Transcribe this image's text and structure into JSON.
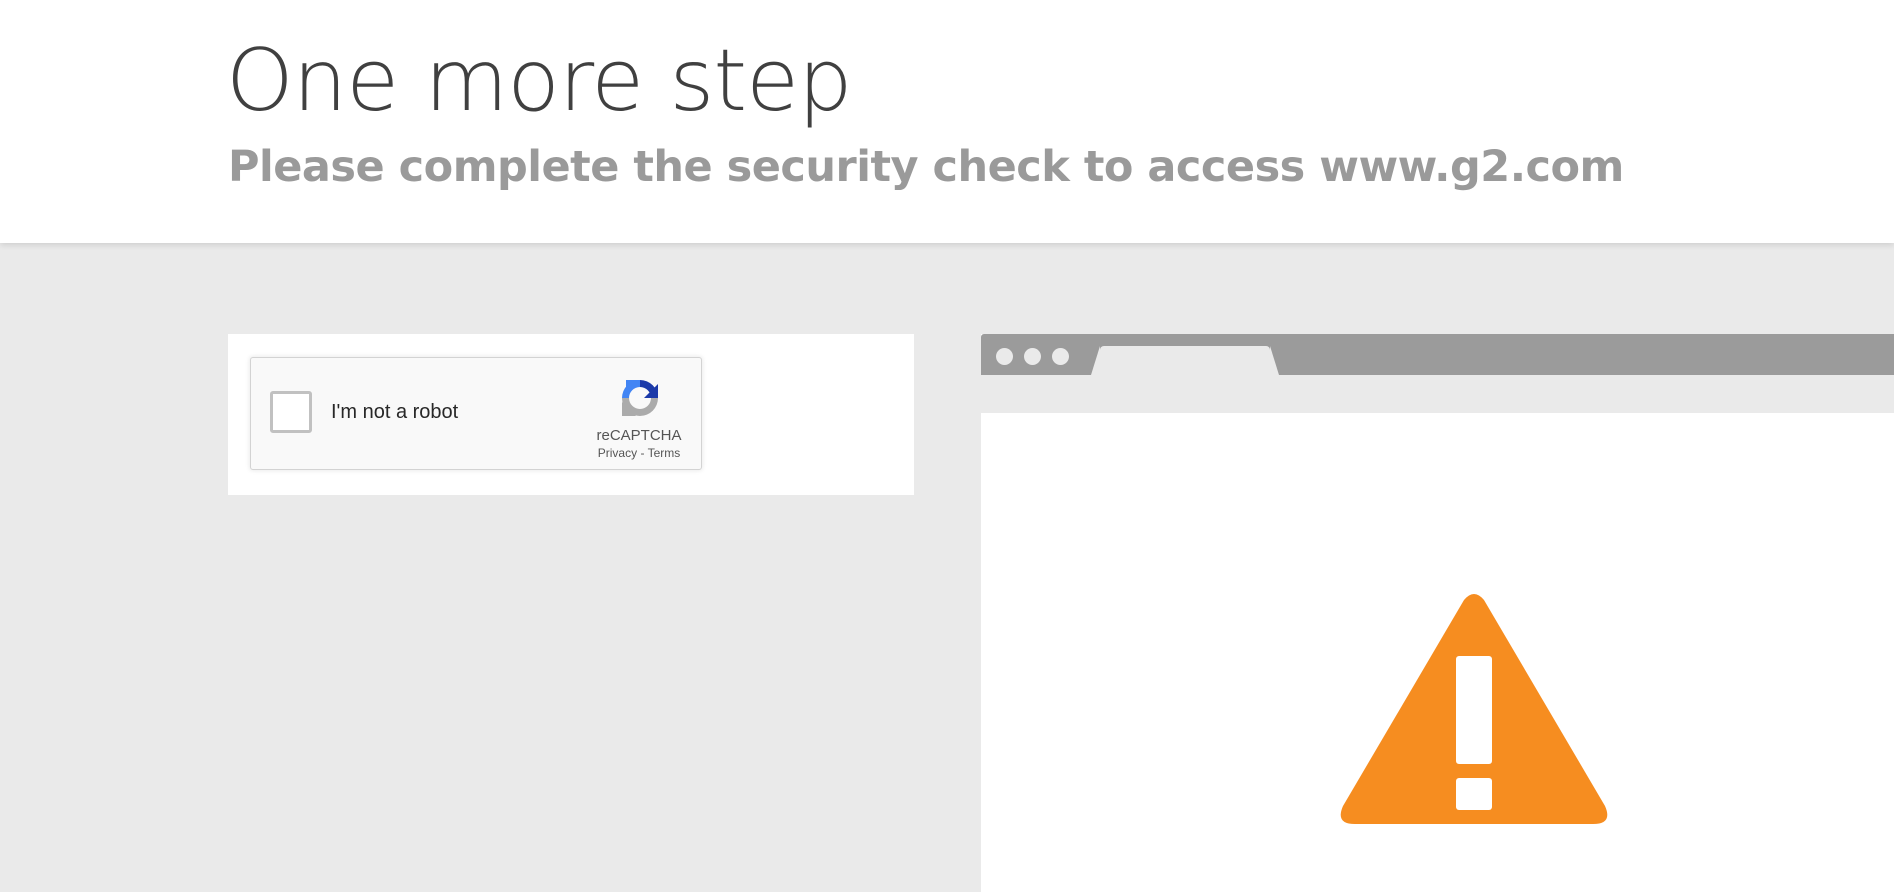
{
  "header": {
    "title": "One more step",
    "subtitle": "Please complete the security check to access www.g2.com"
  },
  "captcha": {
    "checkbox_label": "I'm not a robot",
    "brand": "reCAPTCHA",
    "privacy_link": "Privacy",
    "separator": "-",
    "terms_link": "Terms",
    "logo_icon": "recaptcha-logo-icon",
    "checked": false
  },
  "browser_illustration": {
    "warning_icon": "warning-triangle-icon",
    "warning_color": "#f68d20"
  },
  "colors": {
    "background": "#eaeaea",
    "header_background": "#ffffff",
    "title_color": "#404040",
    "subtitle_color": "#9a9a9a",
    "browser_chrome": "#9b9b9b"
  }
}
